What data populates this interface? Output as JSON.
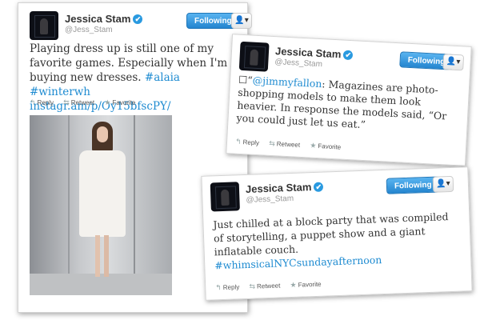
{
  "tweets": [
    {
      "name": "Jessica Stam",
      "handle": "@Jess_Stam",
      "follow_label": "Following",
      "menu_label": "👤▾",
      "text_plain": "Playing dress up is still one of my favorite games. Especially when I'm buying new dresses. ",
      "hashtag1": "#alaia",
      "hashtag2": "#winterwh",
      "link": "instagr.am/p/Oy15bfscPY/",
      "reply": "Reply",
      "retweet": "Retweet",
      "favorite": "Favorite"
    },
    {
      "name": "Jessica Stam",
      "handle": "@Jess_Stam",
      "follow_label": "Following",
      "menu_label": "👤▾",
      "quote_open": "☐“",
      "mention": "@jimmyfallon",
      "text_plain": ": Magazines are photo-shopping models to make them look heavier. In response the models said, “Or you could just let us eat.”",
      "reply": "Reply",
      "retweet": "Retweet",
      "favorite": "Favorite"
    },
    {
      "name": "Jessica Stam",
      "handle": "@Jess_Stam",
      "follow_label": "Following",
      "menu_label": "👤▾",
      "text_plain": "Just chilled at a block party that was compiled of storytelling, a puppet show and a giant inflatable couch.",
      "hashtag": "#whimsicalNYCsundayafternoon",
      "reply": "Reply",
      "retweet": "Retweet",
      "favorite": "Favorite"
    }
  ],
  "icons": {
    "verified": "✔",
    "reply": "↰",
    "retweet": "⇆",
    "favorite": "★"
  }
}
